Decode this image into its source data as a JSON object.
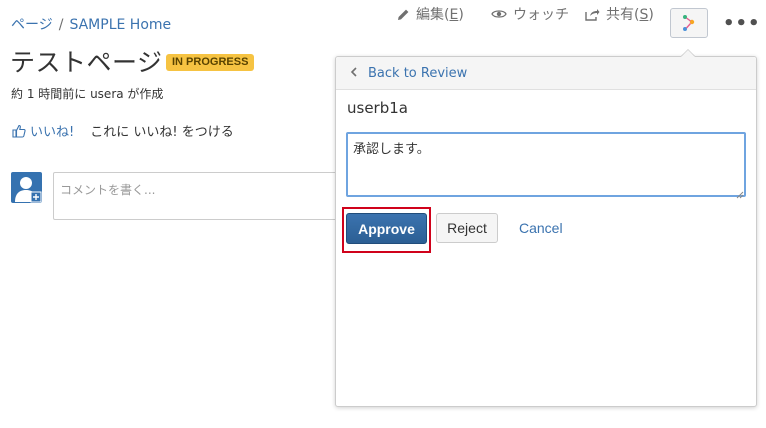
{
  "breadcrumb": {
    "parent": "ページ",
    "separator": "/",
    "space": "SAMPLE Home"
  },
  "page": {
    "title": "テストページ",
    "status": "IN PROGRESS",
    "meta": "約 1 時間前に usera が作成"
  },
  "likes": {
    "like_label": "いいね!",
    "like_message": "これに いいね! をつける"
  },
  "comment": {
    "placeholder": "コメントを書く..."
  },
  "toolbar": {
    "edit_label": "編集(",
    "edit_key": "E",
    "edit_suffix": ")",
    "watch_label": "ウォッチ",
    "share_label": "共有(",
    "share_key": "S",
    "share_suffix": ")",
    "more_label": "•••"
  },
  "review_popup": {
    "back_label": "Back to Review",
    "reviewer": "userb1a",
    "comment_value": "承認します。",
    "approve_label": "Approve",
    "reject_label": "Reject",
    "cancel_label": "Cancel"
  },
  "colors": {
    "link": "#3b73af",
    "status_bg": "#f6c342",
    "highlight": "#d0021b",
    "primary": "#3b73af"
  }
}
